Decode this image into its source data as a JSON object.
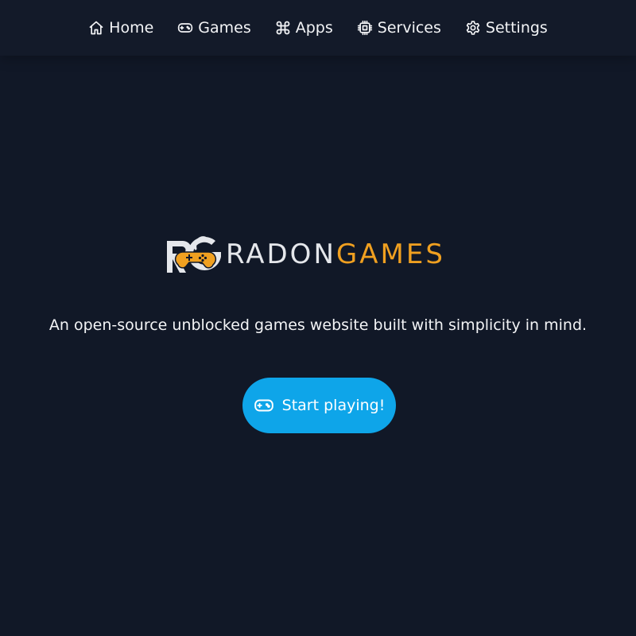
{
  "nav": {
    "items": [
      {
        "label": "Home",
        "icon": "home-icon"
      },
      {
        "label": "Games",
        "icon": "gamepad-icon"
      },
      {
        "label": "Apps",
        "icon": "command-icon"
      },
      {
        "label": "Services",
        "icon": "chip-icon"
      },
      {
        "label": "Settings",
        "icon": "gear-icon"
      }
    ]
  },
  "logo": {
    "mark": "RG",
    "word_1": "RADON",
    "word_2": "GAMES",
    "colors": {
      "light": "#e5e7eb",
      "accent": "#f0a020"
    }
  },
  "hero": {
    "tagline": "An open-source unblocked games website built with simplicity in mind.",
    "cta_label": "Start playing!",
    "cta_icon": "gamepad-icon"
  },
  "theme": {
    "background": "#111827",
    "navbar_background": "#131a29",
    "button_color": "#0ea5e9",
    "text_color": "#f3f4f6"
  }
}
